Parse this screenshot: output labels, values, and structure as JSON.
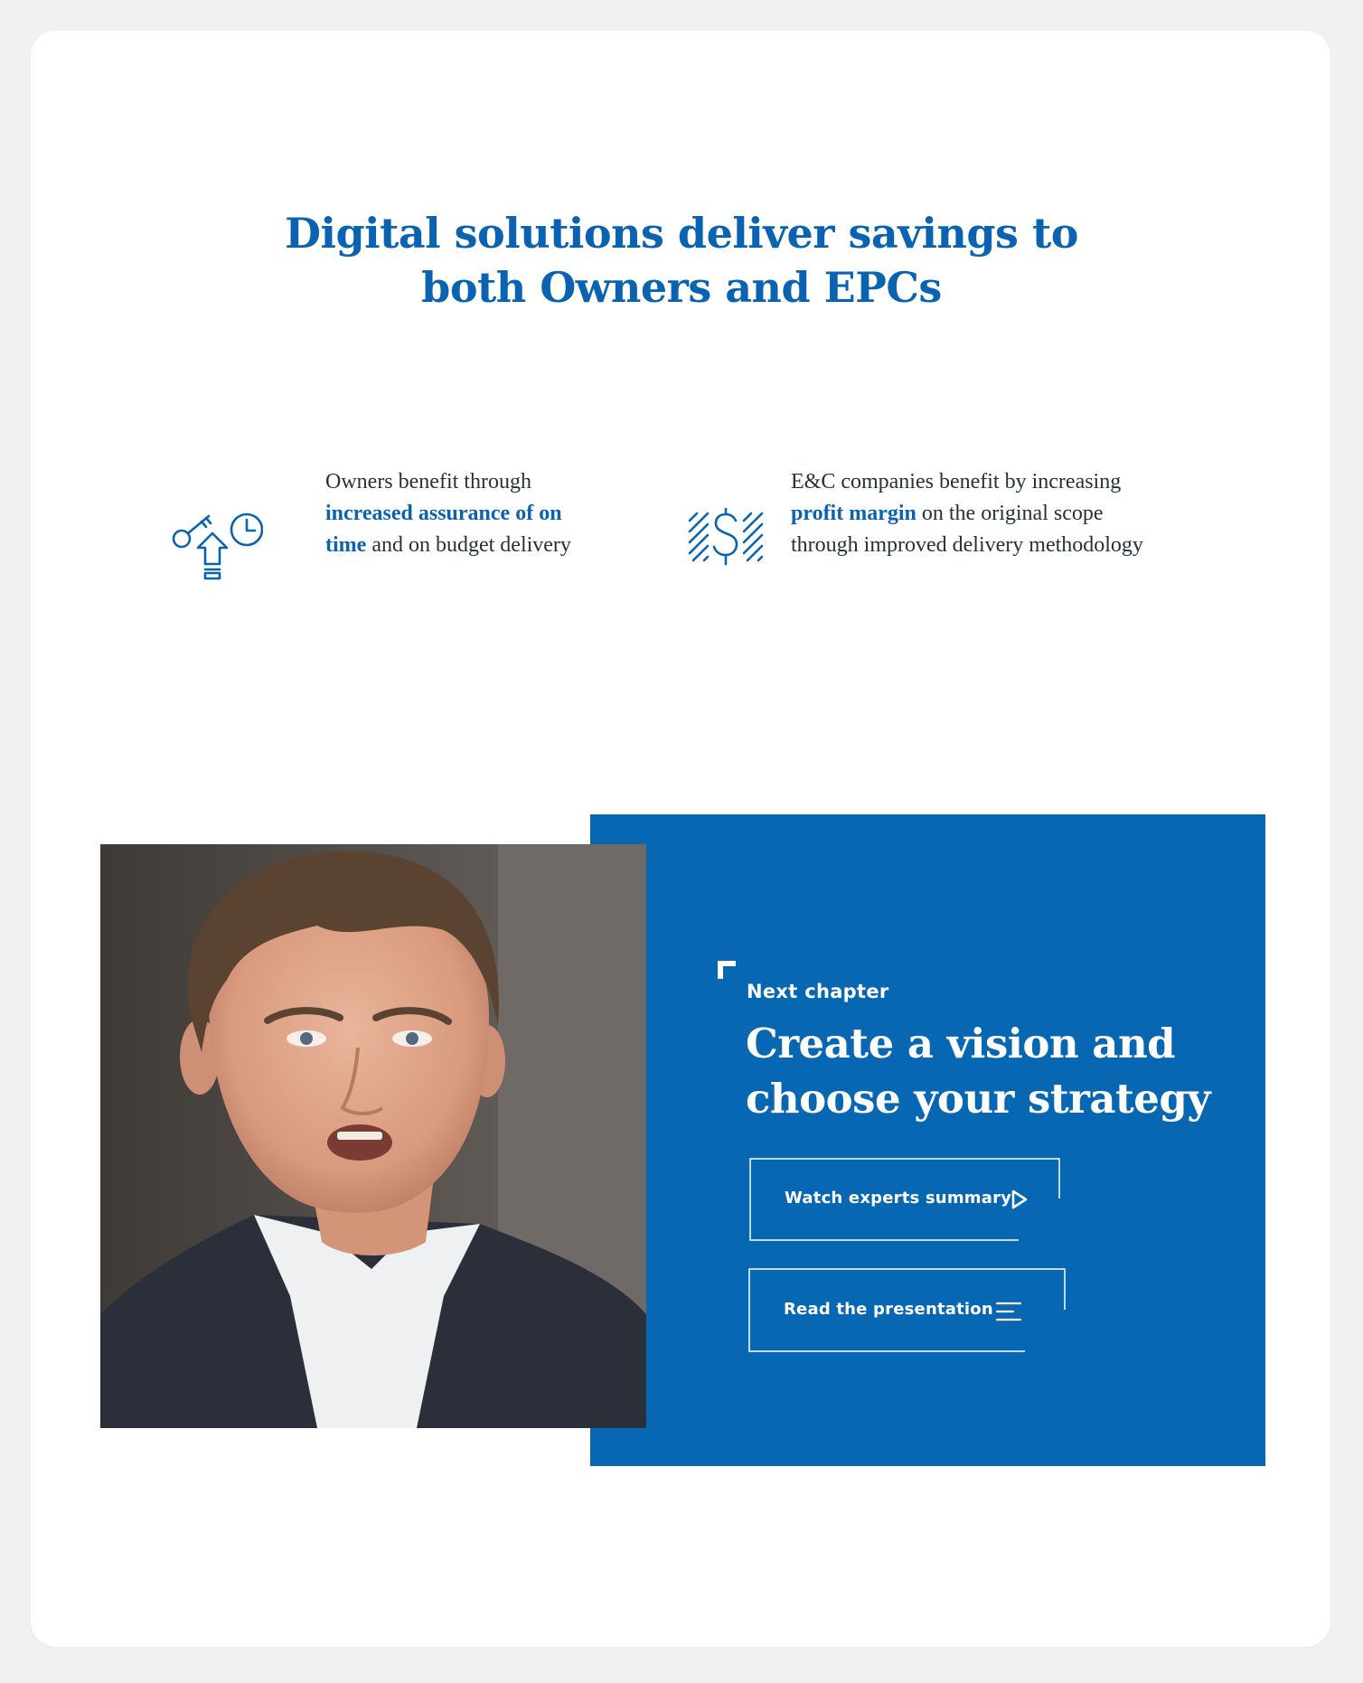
{
  "colors": {
    "brand_blue": "#0a63b1",
    "panel_blue": "#0767b2",
    "body_text": "#27313a",
    "background": "#ffffff"
  },
  "headline": {
    "line1": "Digital solutions deliver savings to",
    "line2": "both Owners and EPCs"
  },
  "benefits": {
    "owners": {
      "icon": "key-arrow-clock-icon",
      "line1": "Owners benefit through",
      "line2_bold": "increased assurance of on",
      "line3_bold": "time",
      "line3_rest": " and on budget delivery"
    },
    "ec": {
      "icon": "dollar-stripes-icon",
      "line1": "E&C companies benefit by increasing",
      "line2_bold": "profit margin",
      "line2_rest": " on the original scope",
      "line3": "through improved delivery methodology"
    }
  },
  "next_chapter": {
    "eyebrow": "Next chapter",
    "title_line1": "Create a vision and",
    "title_line2": "choose your strategy",
    "watch_label": "Watch experts summary",
    "watch_icon": "play-icon",
    "read_label": "Read the presentation",
    "read_icon": "menu-lines-icon"
  },
  "photo": {
    "subject": "presenter-video-still"
  }
}
